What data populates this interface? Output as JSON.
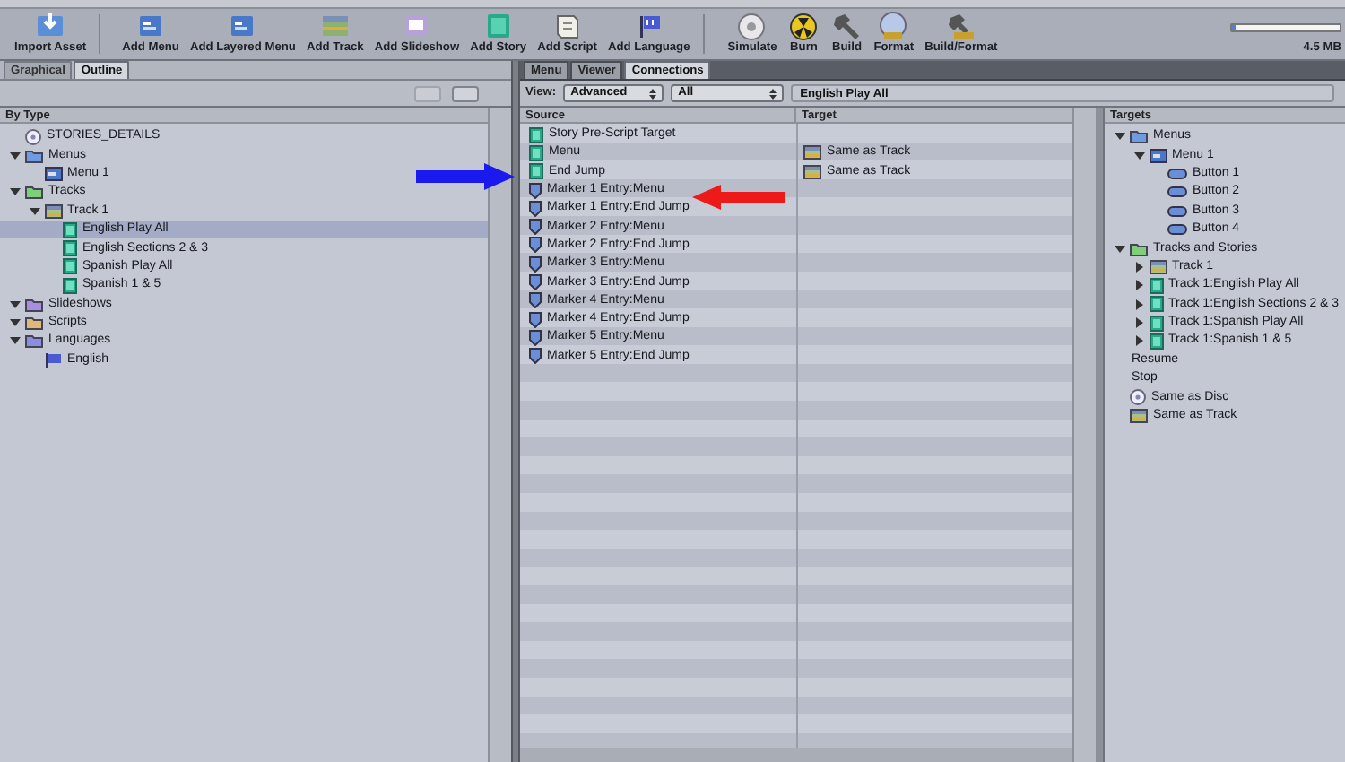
{
  "toolbar": {
    "buttons": [
      {
        "label": "Import Asset",
        "kind": "import"
      },
      {
        "label": "Add Menu",
        "kind": "menu"
      },
      {
        "label": "Add Layered Menu",
        "kind": "menu"
      },
      {
        "label": "Add Track",
        "kind": "track"
      },
      {
        "label": "Add Slideshow",
        "kind": "slideshow"
      },
      {
        "label": "Add Story",
        "kind": "story"
      },
      {
        "label": "Add Script",
        "kind": "script"
      },
      {
        "label": "Add Language",
        "kind": "language"
      },
      {
        "label": "Simulate",
        "kind": "simulate"
      },
      {
        "label": "Burn",
        "kind": "burn"
      },
      {
        "label": "Build",
        "kind": "build"
      },
      {
        "label": "Format",
        "kind": "format"
      },
      {
        "label": "Build/Format",
        "kind": "buildformat"
      }
    ],
    "capacity": {
      "level": 0.04,
      "reading": "4.5 MB"
    }
  },
  "left_tabs": [
    {
      "label": "Graphical",
      "selected": false
    },
    {
      "label": "Outline",
      "selected": true
    }
  ],
  "outline": {
    "header": "By Type",
    "tree": [
      {
        "label": "STORIES_DETAILS",
        "kind": "disc"
      },
      {
        "label": "Menus",
        "kind": "folder",
        "color": "#6f9be0",
        "expanded": true,
        "children": [
          {
            "label": "Menu 1",
            "kind": "menu"
          }
        ]
      },
      {
        "label": "Tracks",
        "kind": "folder",
        "color": "#7fcf7a",
        "expanded": true,
        "children": [
          {
            "label": "Track 1",
            "kind": "track",
            "expanded": true,
            "children": [
              {
                "label": "English Play All",
                "kind": "story",
                "selected": true
              },
              {
                "label": "English Sections 2 & 3",
                "kind": "story",
                "selected": false
              },
              {
                "label": "Spanish Play All",
                "kind": "story",
                "selected": false
              },
              {
                "label": "Spanish 1 & 5",
                "kind": "story",
                "selected": false
              }
            ]
          }
        ]
      },
      {
        "label": "Slideshows",
        "kind": "folder",
        "color": "#a98ee0",
        "expanded": true
      },
      {
        "label": "Scripts",
        "kind": "folder",
        "color": "#e0b878",
        "expanded": true
      },
      {
        "label": "Languages",
        "kind": "folder",
        "color": "#8a8ee0",
        "expanded": true,
        "children": [
          {
            "label": "English",
            "kind": "language"
          }
        ]
      }
    ]
  },
  "right_tabs": [
    {
      "label": "Menu",
      "selected": false
    },
    {
      "label": "Viewer",
      "selected": false
    },
    {
      "label": "Connections",
      "selected": true
    }
  ],
  "connections": {
    "view_label": "View:",
    "view_select": "Advanced",
    "filter_select": "All",
    "source_field": "English Play All",
    "columns": [
      "Source",
      "Target"
    ],
    "rows": [
      {
        "source": {
          "label": "Story Pre-Script Target",
          "kind": "story"
        }
      },
      {
        "source": {
          "label": "Menu",
          "kind": "story"
        },
        "target": {
          "label": "Same as Track",
          "kind": "track"
        }
      },
      {
        "source": {
          "label": "End Jump",
          "kind": "story"
        },
        "target": {
          "label": "Same as Track",
          "kind": "track"
        }
      },
      {
        "source": {
          "label": "Marker 1 Entry:Menu",
          "kind": "marker"
        }
      },
      {
        "source": {
          "label": "Marker 1 Entry:End Jump",
          "kind": "marker"
        }
      },
      {
        "source": {
          "label": "Marker 2 Entry:Menu",
          "kind": "marker"
        }
      },
      {
        "source": {
          "label": "Marker 2 Entry:End Jump",
          "kind": "marker"
        }
      },
      {
        "source": {
          "label": "Marker 3 Entry:Menu",
          "kind": "marker"
        }
      },
      {
        "source": {
          "label": "Marker 3 Entry:End Jump",
          "kind": "marker"
        }
      },
      {
        "source": {
          "label": "Marker 4 Entry:Menu",
          "kind": "marker"
        }
      },
      {
        "source": {
          "label": "Marker 4 Entry:End Jump",
          "kind": "marker"
        }
      },
      {
        "source": {
          "label": "Marker 5 Entry:Menu",
          "kind": "marker"
        }
      },
      {
        "source": {
          "label": "Marker 5 Entry:End Jump",
          "kind": "marker"
        }
      }
    ]
  },
  "targets": {
    "header": "Targets",
    "tree": [
      {
        "label": "Menus",
        "kind": "folder",
        "color": "#6f9be0",
        "expanded": true,
        "children": [
          {
            "label": "Menu 1",
            "kind": "menu",
            "expanded": true,
            "children": [
              {
                "label": "Button 1",
                "kind": "button"
              },
              {
                "label": "Button 2",
                "kind": "button"
              },
              {
                "label": "Button 3",
                "kind": "button"
              },
              {
                "label": "Button 4",
                "kind": "button"
              }
            ]
          }
        ]
      },
      {
        "label": "Tracks and Stories",
        "kind": "folder",
        "color": "#7fcf7a",
        "expanded": true,
        "children": [
          {
            "label": "Track 1",
            "kind": "track",
            "expanded": false
          },
          {
            "label": "Track 1:English Play All",
            "kind": "story",
            "expanded": false
          },
          {
            "label": "Track 1:English Sections 2 & 3",
            "kind": "story",
            "expanded": false
          },
          {
            "label": "Track 1:Spanish Play All",
            "kind": "story",
            "expanded": false
          },
          {
            "label": "Track 1:Spanish 1 & 5",
            "kind": "story",
            "expanded": false
          }
        ]
      },
      {
        "label": "Resume",
        "kind": "plain"
      },
      {
        "label": "Stop",
        "kind": "plain"
      },
      {
        "label": "Same as Disc",
        "kind": "disc"
      },
      {
        "label": "Same as Track",
        "kind": "track"
      }
    ]
  }
}
